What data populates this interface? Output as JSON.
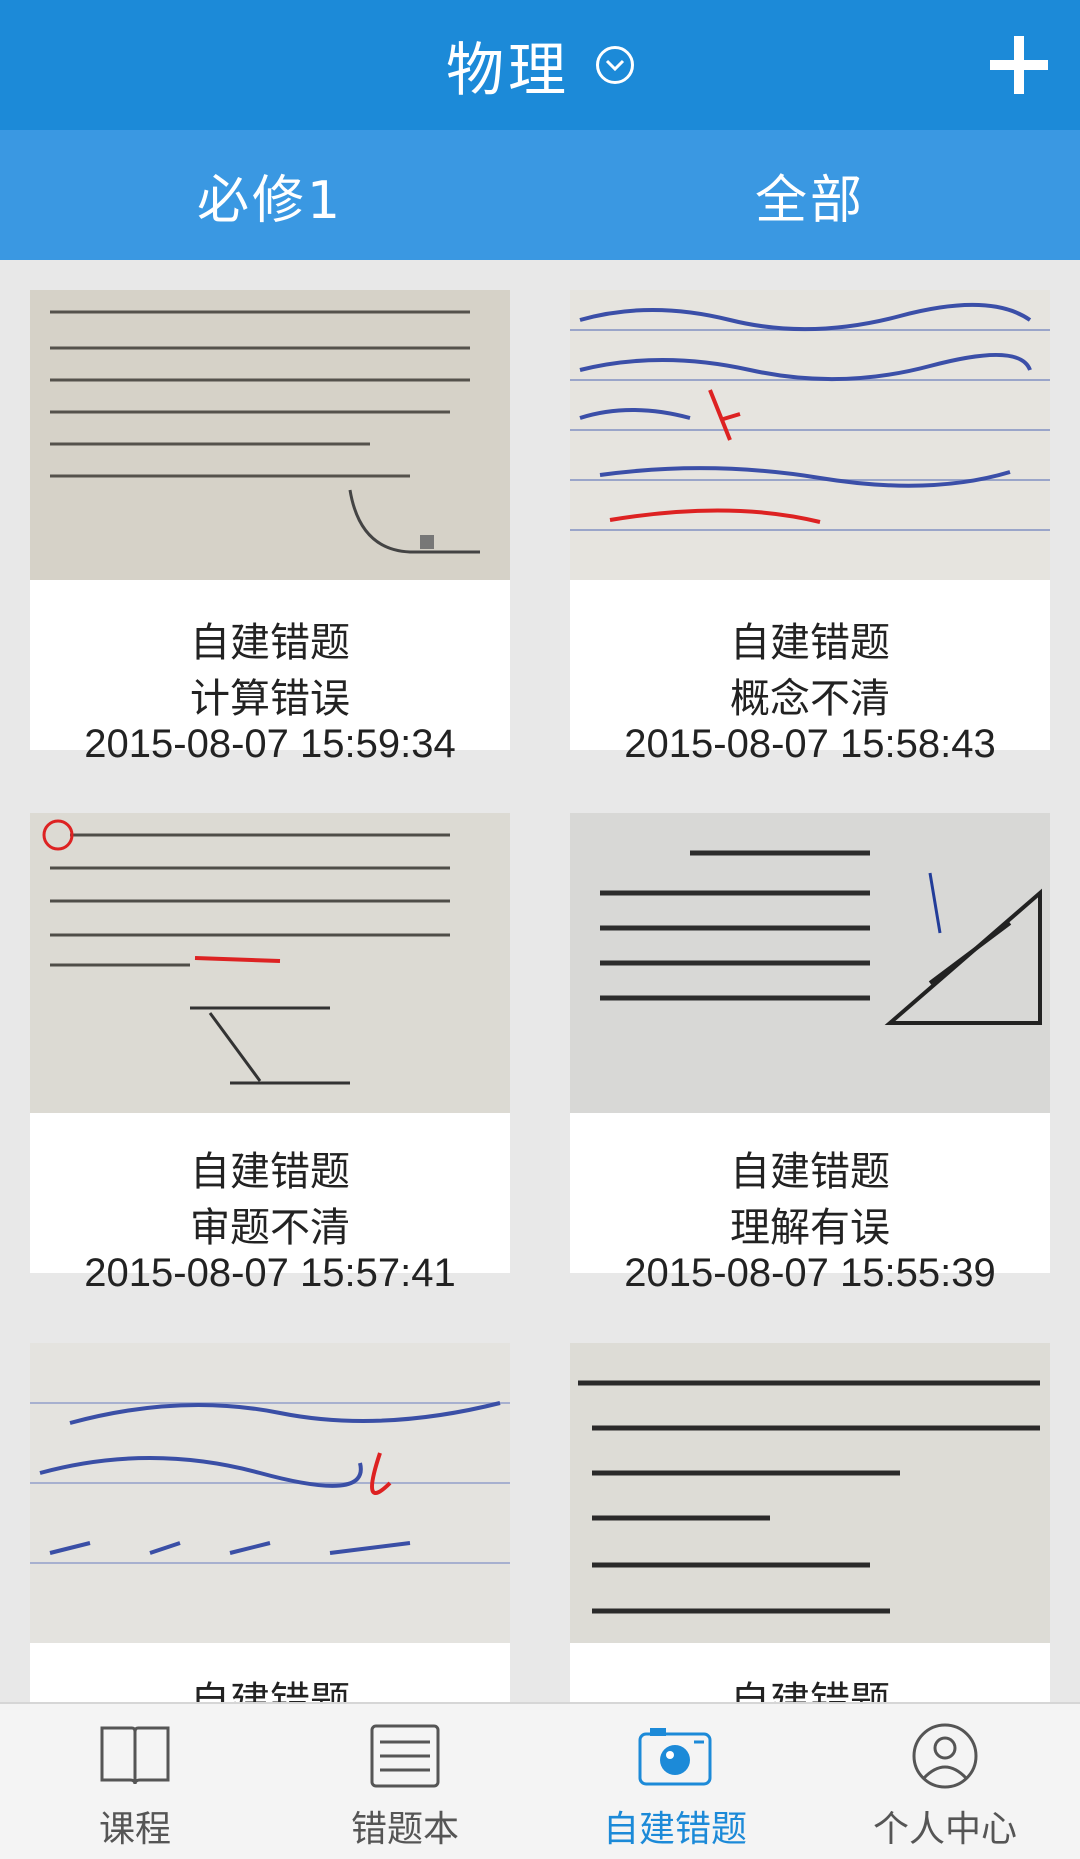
{
  "header": {
    "title": "物理",
    "dropdown_icon": "chevron-down-icon",
    "add_icon": "plus-icon"
  },
  "tabs": [
    {
      "label": "必修1"
    },
    {
      "label": "全部"
    }
  ],
  "cards": [
    {
      "source": "自建错题",
      "reason": "计算错误",
      "time": "2015-08-07 15:59:34"
    },
    {
      "source": "自建错题",
      "reason": "概念不清",
      "time": "2015-08-07 15:58:43"
    },
    {
      "source": "自建错题",
      "reason": "审题不清",
      "time": "2015-08-07 15:57:41"
    },
    {
      "source": "自建错题",
      "reason": "理解有误",
      "time": "2015-08-07 15:55:39"
    },
    {
      "source": "自建错题",
      "reason": "",
      "time": ""
    },
    {
      "source": "自建错题",
      "reason": "",
      "time": ""
    }
  ],
  "nav": [
    {
      "label": "课程",
      "icon": "book-icon"
    },
    {
      "label": "错题本",
      "icon": "notebook-icon"
    },
    {
      "label": "自建错题",
      "icon": "camera-icon"
    },
    {
      "label": "个人中心",
      "icon": "person-icon"
    }
  ],
  "colors": {
    "header": "#1c8ad8",
    "tabs": "#3a98e2",
    "active_nav": "#1c8ad8",
    "background": "#e9e9e9"
  }
}
